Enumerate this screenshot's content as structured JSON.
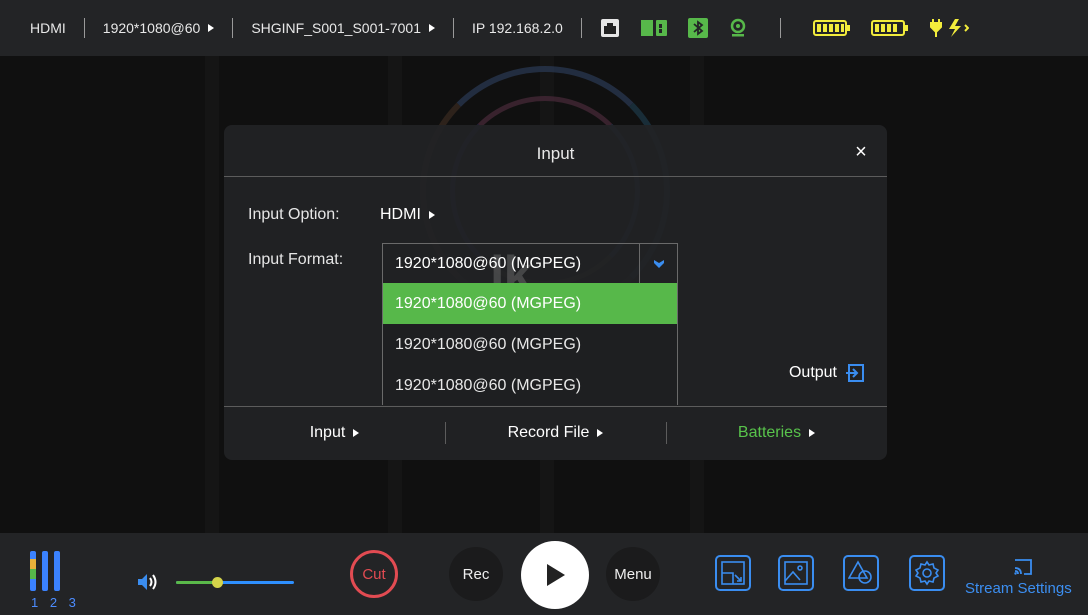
{
  "colors": {
    "accent_green": "#57b84a",
    "accent_blue": "#3a8df0",
    "cut_red": "#e24b52",
    "bar_bg": "#232426"
  },
  "topbar": {
    "source": "HDMI",
    "resolution": "1920*1080@60",
    "filename": "SHGINF_S001_S001-7001",
    "ip": "IP 192.168.2.0",
    "icons": [
      "ethernet-icon",
      "sd-card-icon",
      "bluetooth-icon",
      "webcam-icon",
      "battery-icon",
      "battery-icon",
      "power-plug-icon"
    ]
  },
  "dialog": {
    "title": "Input",
    "close": "×",
    "input_option_label": "Input Option:",
    "input_option_value": "HDMI",
    "input_format_label": "Input Format:",
    "input_format_value": "1920*1080@60 (MGPEG)",
    "format_options": [
      "1920*1080@60 (MGPEG)",
      "1920*1080@60 (MGPEG)",
      "1920*1080@60 (MGPEG)"
    ],
    "output_label": "Output",
    "tabs": [
      "Input",
      "Record File",
      "Batteries"
    ],
    "active_tab": "Batteries"
  },
  "bottombar": {
    "meter_labels": "1 2 3",
    "volume": 0.35,
    "cut_label": "Cut",
    "rec_label": "Rec",
    "menu_label": "Menu",
    "stream_label": "Stream Settings"
  }
}
